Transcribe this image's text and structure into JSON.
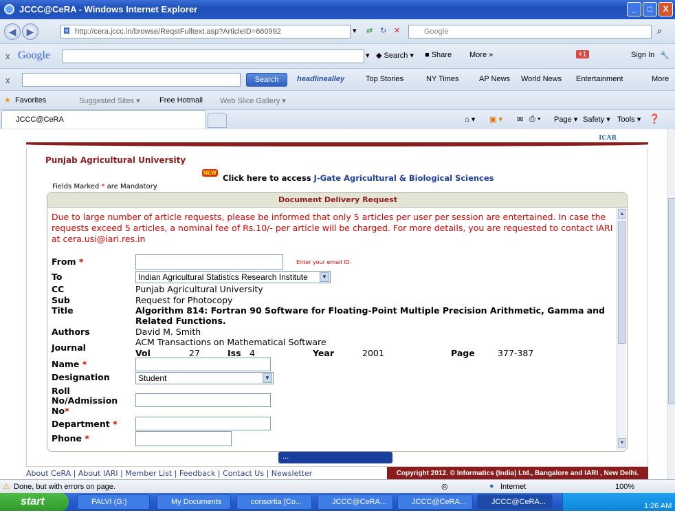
{
  "window": {
    "title": "JCCC@CeRA - Windows Internet Explorer",
    "minimize": "_",
    "maximize": "□",
    "close": "X"
  },
  "address": {
    "url": "http://cera.jccc.in/browse/ReqstFulltext.asp?ArticleID=660992",
    "search_engine": "Google"
  },
  "google_bar": {
    "logo": "Google",
    "close": "x",
    "search": "Search",
    "share": "Share",
    "more": "More »",
    "badge": "+1",
    "sign_in": "Sign In"
  },
  "headline_bar": {
    "close": "x",
    "search_button": "Search",
    "brand": "headlinealley",
    "links": [
      "Top Stories",
      "NY Times",
      "AP News",
      "World News",
      "Entertainment",
      "More"
    ]
  },
  "favorites_bar": {
    "favorites": "Favorites",
    "items": [
      "Suggested Sites ▾",
      "Free Hotmail",
      "Web Slice Gallery ▾"
    ]
  },
  "tab": {
    "label": "JCCC@CeRA"
  },
  "command_bar": {
    "items": [
      "Page ▾",
      "Safety ▾",
      "Tools ▾"
    ]
  },
  "page": {
    "header_logo": "ICAR",
    "institution": "Punjab Agricultural University",
    "new_badge": "NEW",
    "access_prefix": "Click here to access ",
    "access_link": "J-Gate Agricultural & Biological Sciences",
    "mandatory_note_prefix": "Fields Marked ",
    "mandatory_note_star": "*",
    "mandatory_note_suffix": " are Mandatory",
    "form_title": "Document Delivery Request",
    "notice": "Due to large number of article requests, please be informed that only 5 articles per user per session are entertained. In case the requests exceed 5 articles, a nominal fee of Rs.10/- per article will be charged. For more details, you are requested to contact IARI at cera.usi@iari.res.in",
    "from_label": "From ",
    "from_value": "",
    "email_hint": "Enter your email ID.",
    "to_label": "To",
    "to_value": "Indian Agricultural Statistics Research Institute",
    "cc_label": "CC",
    "cc_value": "Punjab Agricultural University",
    "sub_label": "Sub",
    "sub_value": "Request for Photocopy",
    "title_label": "Title",
    "title_value_1": "Algorithm 814: Fortran 90 Software for Floating-Point Multiple Precision Arithmetic, Gamma and",
    "title_value_2": "Related Functions.",
    "authors_label": "Authors",
    "authors_value": "David M. Smith",
    "journal_label": "Journal",
    "journal_value": "ACM Transactions on Mathematical Software",
    "vol_label": "Vol",
    "vol_value": "27",
    "iss_label": "Iss",
    "iss_value": "4",
    "year_label": "Year",
    "year_value": "2001",
    "page_label": "Page",
    "page_value": "377-387",
    "name_label": "Name ",
    "designation_label": "Designation",
    "designation_value": "Student",
    "roll_label_1": "Roll",
    "roll_label_2": "No/Admission",
    "roll_label_3": "No",
    "department_label": "Department ",
    "phone_label": "Phone ",
    "star": "*",
    "dock": "...",
    "footer_links": "About CeRA | About IARI | Member List | Feedback | Contact Us | Newsletter",
    "copyright": "Copyright 2012. © Informatics (India) Ltd., Bangalore and IARI , New Delhi."
  },
  "status_bar": {
    "message": "Done, but with errors on page.",
    "zone": "Internet",
    "zoom": "100%"
  },
  "taskbar": {
    "start": "start",
    "tasks": [
      "PALVI (G:)",
      "My Documents",
      "consortia [Co...",
      "JCCC@CeRA...",
      "JCCC@CeRA...",
      "JCCC@CeRA..."
    ],
    "time": "1:26 AM"
  },
  "colors": {
    "title_blue": "#245ccf",
    "maroon": "#8a1c1c",
    "required_red": "#d40000",
    "link_blue": "#1f3f9a"
  }
}
